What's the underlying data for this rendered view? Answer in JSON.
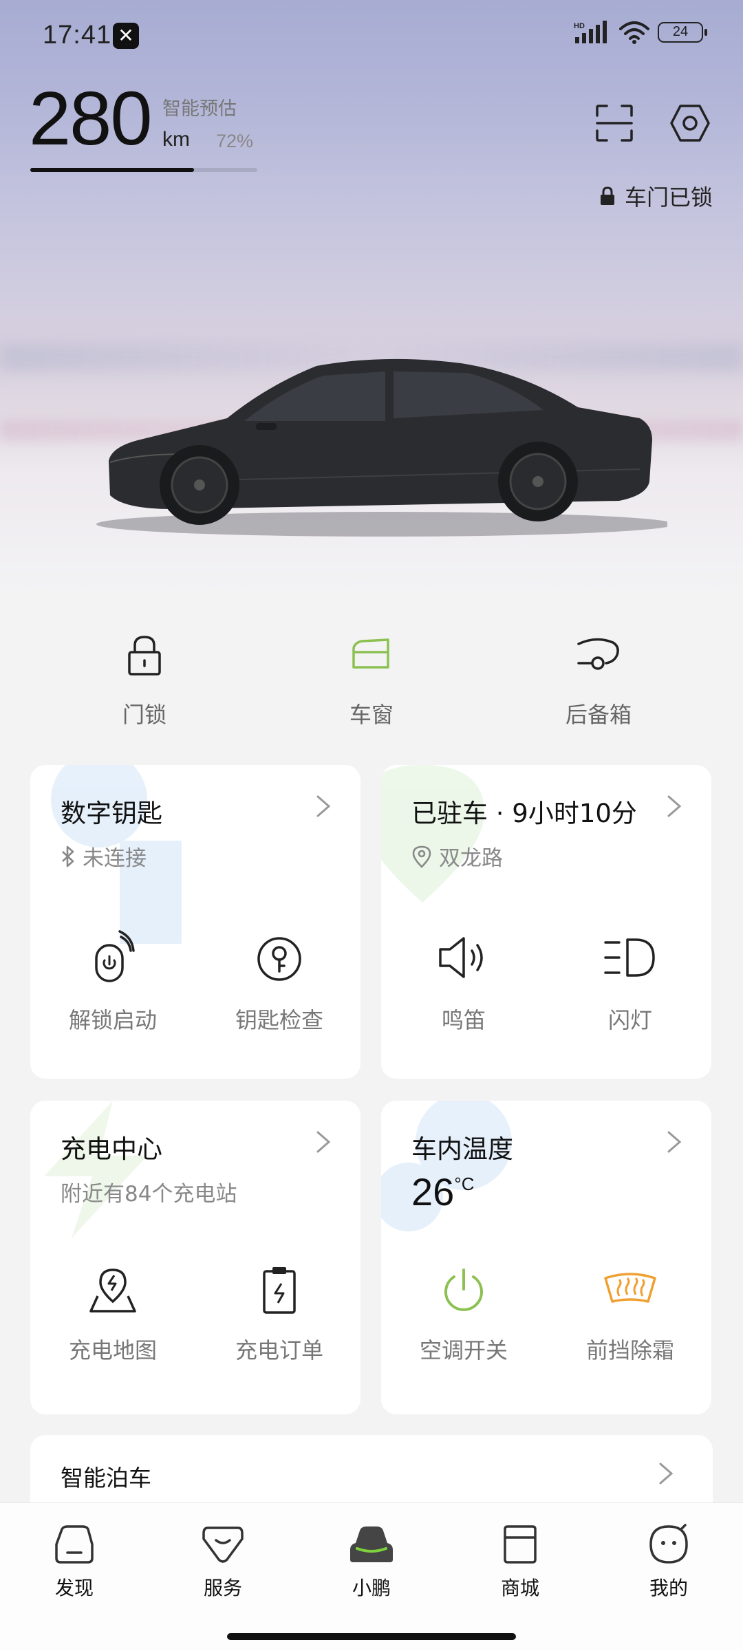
{
  "status_bar": {
    "time": "17:41",
    "app_icon": "xpeng-logo-icon",
    "battery": "24"
  },
  "range": {
    "value": "280",
    "estimate_label": "智能预估",
    "unit": "km",
    "percent": "72%",
    "battery_fraction": 0.72
  },
  "header": {
    "scan_icon": "scan-icon",
    "settings_icon": "settings-hex-icon",
    "lock_status": "车门已锁"
  },
  "quick_controls": [
    {
      "label": "门锁",
      "icon": "lock-icon"
    },
    {
      "label": "车窗",
      "icon": "window-icon"
    },
    {
      "label": "后备箱",
      "icon": "trunk-icon"
    }
  ],
  "cards": {
    "digital_key": {
      "title": "数字钥匙",
      "status": "未连接",
      "actions": [
        "解锁启动",
        "钥匙检查"
      ]
    },
    "parked": {
      "title": "已驻车 · 9小时10分",
      "location": "双龙路",
      "actions": [
        "鸣笛",
        "闪灯"
      ]
    },
    "charging": {
      "title": "充电中心",
      "subtitle": "附近有84个充电站",
      "actions": [
        "充电地图",
        "充电订单"
      ]
    },
    "cabin_temp": {
      "title": "车内温度",
      "value": "26",
      "unit": "°C",
      "actions": [
        "空调开关",
        "前挡除霜"
      ]
    }
  },
  "parking": {
    "title": "智能泊车"
  },
  "bottom_nav": [
    {
      "label": "发现",
      "icon": "discover-icon"
    },
    {
      "label": "服务",
      "icon": "service-icon"
    },
    {
      "label": "小鹏",
      "icon": "car-icon"
    },
    {
      "label": "商城",
      "icon": "shop-icon"
    },
    {
      "label": "我的",
      "icon": "profile-icon"
    }
  ],
  "colors": {
    "accent_green": "#8cc152",
    "accent_orange": "#f0a030",
    "text_primary": "#111111",
    "text_secondary": "#777777"
  }
}
